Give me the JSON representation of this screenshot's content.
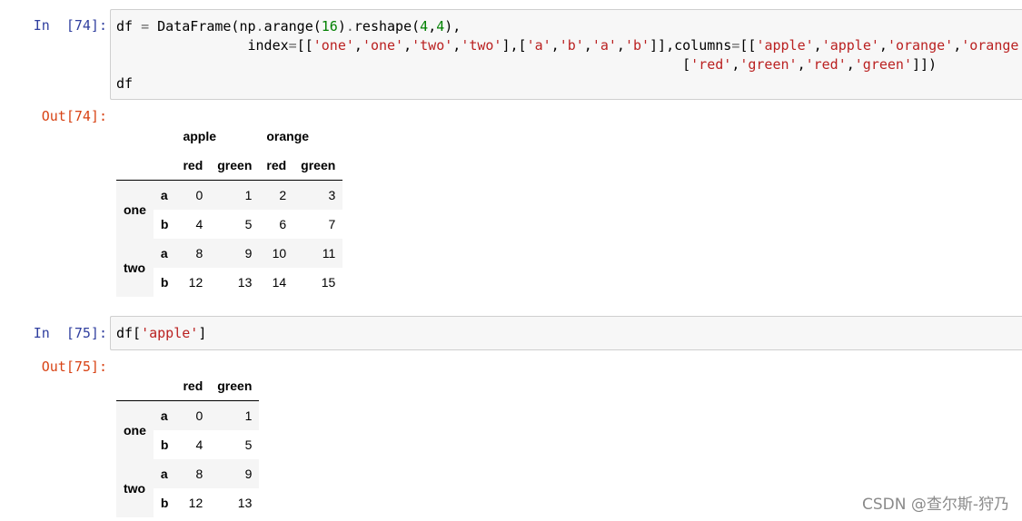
{
  "cells": [
    {
      "in_prompt": "In  [74]:",
      "out_prompt": "Out[74]:",
      "code_lines": [
        [
          {
            "t": "df "
          },
          {
            "t": "=",
            "c": "op"
          },
          {
            "t": " DataFrame(np"
          },
          {
            "t": ".",
            "c": "op"
          },
          {
            "t": "arange("
          },
          {
            "t": "16",
            "c": "num"
          },
          {
            "t": ")"
          },
          {
            "t": ".",
            "c": "op"
          },
          {
            "t": "reshape("
          },
          {
            "t": "4",
            "c": "num"
          },
          {
            "t": ","
          },
          {
            "t": "4",
            "c": "num"
          },
          {
            "t": "),"
          }
        ],
        [
          {
            "t": "                index"
          },
          {
            "t": "=",
            "c": "op"
          },
          {
            "t": "[["
          },
          {
            "t": "'one'",
            "c": "str"
          },
          {
            "t": ","
          },
          {
            "t": "'one'",
            "c": "str"
          },
          {
            "t": ","
          },
          {
            "t": "'two'",
            "c": "str"
          },
          {
            "t": ","
          },
          {
            "t": "'two'",
            "c": "str"
          },
          {
            "t": "],["
          },
          {
            "t": "'a'",
            "c": "str"
          },
          {
            "t": ","
          },
          {
            "t": "'b'",
            "c": "str"
          },
          {
            "t": ","
          },
          {
            "t": "'a'",
            "c": "str"
          },
          {
            "t": ","
          },
          {
            "t": "'b'",
            "c": "str"
          },
          {
            "t": "]],columns"
          },
          {
            "t": "=",
            "c": "op"
          },
          {
            "t": "[["
          },
          {
            "t": "'apple'",
            "c": "str"
          },
          {
            "t": ","
          },
          {
            "t": "'apple'",
            "c": "str"
          },
          {
            "t": ","
          },
          {
            "t": "'orange'",
            "c": "str"
          },
          {
            "t": ","
          },
          {
            "t": "'orange'",
            "c": "str"
          },
          {
            "t": "],"
          }
        ],
        [
          {
            "t": "                                                                     ["
          },
          {
            "t": "'red'",
            "c": "str"
          },
          {
            "t": ","
          },
          {
            "t": "'green'",
            "c": "str"
          },
          {
            "t": ","
          },
          {
            "t": "'red'",
            "c": "str"
          },
          {
            "t": ","
          },
          {
            "t": "'green'",
            "c": "str"
          },
          {
            "t": "]])"
          }
        ],
        [
          {
            "t": "df"
          }
        ]
      ],
      "output": {
        "header_top": [
          {
            "label": "",
            "span": 2
          },
          {
            "label": "apple",
            "span": 2
          },
          {
            "label": "orange",
            "span": 2
          }
        ],
        "header_bottom": [
          "",
          "",
          "red",
          "green",
          "red",
          "green"
        ],
        "rows": [
          {
            "lvl0": "one",
            "lvl1": "a",
            "values": [
              "0",
              "1",
              "2",
              "3"
            ]
          },
          {
            "lvl0": "",
            "lvl1": "b",
            "values": [
              "4",
              "5",
              "6",
              "7"
            ]
          },
          {
            "lvl0": "two",
            "lvl1": "a",
            "values": [
              "8",
              "9",
              "10",
              "11"
            ]
          },
          {
            "lvl0": "",
            "lvl1": "b",
            "values": [
              "12",
              "13",
              "14",
              "15"
            ]
          }
        ]
      }
    },
    {
      "in_prompt": "In  [75]:",
      "out_prompt": "Out[75]:",
      "code_lines": [
        [
          {
            "t": "df["
          },
          {
            "t": "'apple'",
            "c": "str"
          },
          {
            "t": "]"
          }
        ]
      ],
      "output": {
        "header_top": [],
        "header_bottom": [
          "",
          "",
          "red",
          "green"
        ],
        "rows": [
          {
            "lvl0": "one",
            "lvl1": "a",
            "values": [
              "0",
              "1"
            ]
          },
          {
            "lvl0": "",
            "lvl1": "b",
            "values": [
              "4",
              "5"
            ]
          },
          {
            "lvl0": "two",
            "lvl1": "a",
            "values": [
              "8",
              "9"
            ]
          },
          {
            "lvl0": "",
            "lvl1": "b",
            "values": [
              "12",
              "13"
            ]
          }
        ]
      }
    }
  ],
  "watermark": "CSDN @查尔斯-狩乃"
}
